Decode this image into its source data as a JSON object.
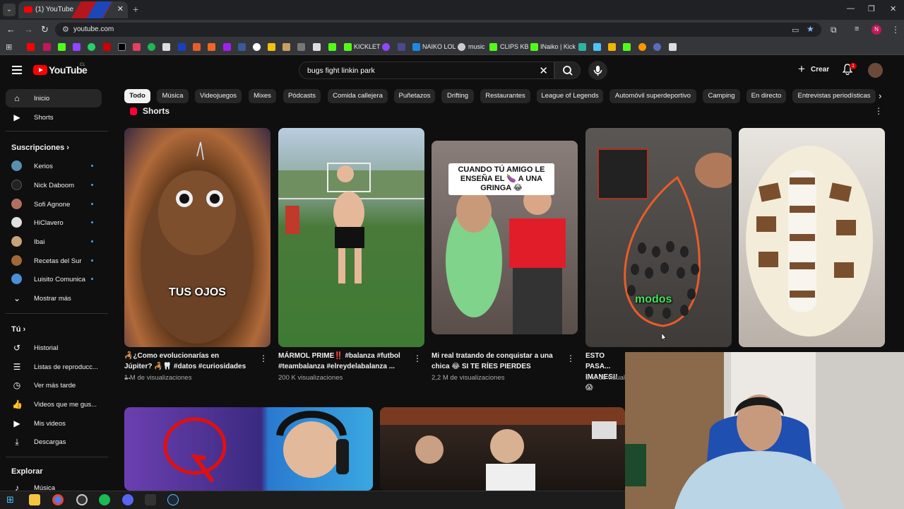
{
  "browser": {
    "tab_title": "(1) YouTube",
    "url": "youtube.com",
    "bookmarks": [
      "KICKLET",
      "NAIKO LOL",
      "music",
      "CLIPS KB",
      "INaiko | Kick"
    ]
  },
  "header": {
    "logo_text": "YouTube",
    "country_code": "CL",
    "search_query": "bugs fight linkin park",
    "create_label": "Crear",
    "notification_count": "1"
  },
  "chips": [
    "Todo",
    "Música",
    "Videojuegos",
    "Mixes",
    "Pódcasts",
    "Comida callejera",
    "Puñetazos",
    "Drifting",
    "Restaurantes",
    "League of Legends",
    "Automóvil superdeportivo",
    "Camping",
    "En directo",
    "Entrevistas periodísticas"
  ],
  "sidebar": {
    "main": [
      {
        "label": "Inicio",
        "icon": "home-icon"
      },
      {
        "label": "Shorts",
        "icon": "shorts-icon"
      }
    ],
    "subscriptions_title": "Suscripciones",
    "subscriptions": [
      {
        "label": "Kerios",
        "color": "#5a8fb0"
      },
      {
        "label": "Nick Daboom",
        "color": "#222222"
      },
      {
        "label": "Sofi Agnone",
        "color": "#b07060"
      },
      {
        "label": "HiClavero",
        "color": "#e0e0e0"
      },
      {
        "label": "Ibai",
        "color": "#c9a27a"
      },
      {
        "label": "Recetas del Sur",
        "color": "#a0683a"
      },
      {
        "label": "Luisito Comunica",
        "color": "#4a90d9"
      }
    ],
    "show_more": "Mostrar más",
    "you_title": "Tú",
    "you": [
      {
        "label": "Historial",
        "icon": "history-icon"
      },
      {
        "label": "Listas de reproducc...",
        "icon": "playlist-icon"
      },
      {
        "label": "Ver más tarde",
        "icon": "clock-icon"
      },
      {
        "label": "Videos que me gus...",
        "icon": "thumbs-up-icon"
      },
      {
        "label": "Mis videos",
        "icon": "video-icon"
      },
      {
        "label": "Descargas",
        "icon": "download-icon"
      }
    ],
    "explore_title": "Explorar",
    "explore": [
      {
        "label": "Música",
        "icon": "music-icon"
      }
    ]
  },
  "shorts": {
    "section_title": "Shorts",
    "items": [
      {
        "title": "🦂¿Como evolucionarías en Júpiter? 🦂🦷 #datos #curiosidades ...",
        "views": "1 M de visualizaciones",
        "overlay": "TUS OJOS"
      },
      {
        "title": "MÁRMOL PRIME‼️ #balanza #futbol #teambalanza #elreydelabalanza ...",
        "views": "200 K visualizaciones",
        "overlay": ""
      },
      {
        "title": "Mi real tratando de conquistar a una chica 😂 SI TE RÍES PIERDES",
        "views": "2,2 M de visualizaciones",
        "overlay": "CUANDO TÚ AMIGO LE ENSEÑA EL 🍆 A UNA GRINGA 😂"
      },
      {
        "title": "ESTO PASA... IMANES!! 😱",
        "views": "3 M de visuali...",
        "overlay": "modos"
      },
      {
        "title": "",
        "views": "",
        "overlay": ""
      }
    ]
  }
}
